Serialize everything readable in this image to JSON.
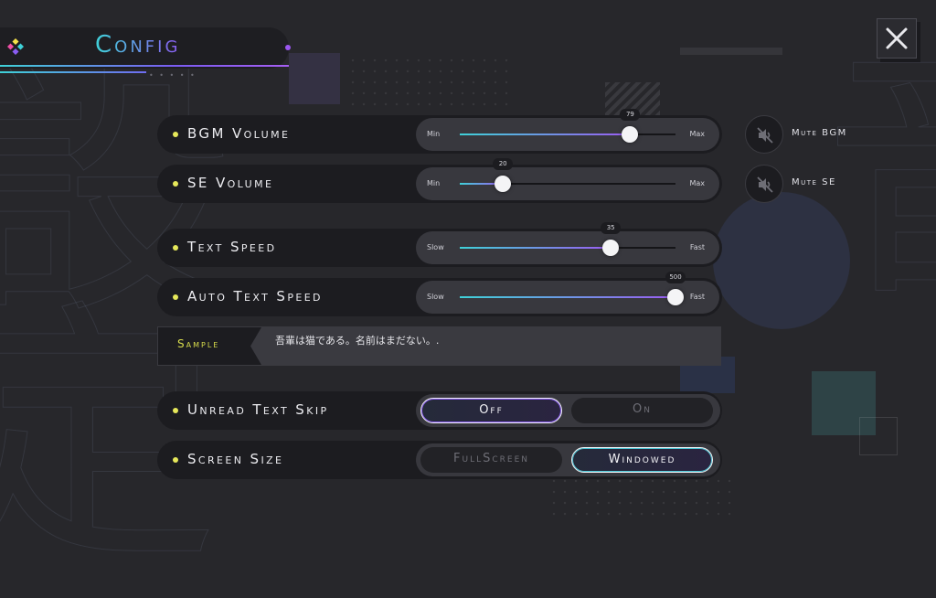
{
  "header": {
    "title": "Config"
  },
  "settings": {
    "bgm": {
      "label": "BGM Volume",
      "min": "Min",
      "max": "Max",
      "value": 79,
      "range": [
        0,
        100
      ]
    },
    "se": {
      "label": "SE Volume",
      "min": "Min",
      "max": "Max",
      "value": 20,
      "range": [
        0,
        100
      ]
    },
    "text_speed": {
      "label": "Text Speed",
      "min": "Slow",
      "max": "Fast",
      "value": 35,
      "range": [
        0,
        50
      ]
    },
    "auto_speed": {
      "label": "Auto Text Speed",
      "min": "Slow",
      "max": "Fast",
      "value": 500,
      "range": [
        0,
        500
      ]
    }
  },
  "mute": {
    "bgm_label": "Mute BGM",
    "se_label": "Mute SE"
  },
  "sample": {
    "label": "Sample",
    "text": "吾輩は猫である。名前はまだない。."
  },
  "unread_skip": {
    "label": "Unread Text Skip",
    "off": "Off",
    "on": "On",
    "selected": "Off"
  },
  "screen_size": {
    "label": "Screen Size",
    "fullscreen": "FullScreen",
    "windowed": "Windowed",
    "selected": "Windowed"
  },
  "colors": {
    "accent_cyan": "#3fd1d8",
    "accent_purple": "#9b5cf2",
    "bullet": "#e6e85a"
  },
  "icons": {
    "close": "close-icon",
    "mute": "speaker-mute-icon",
    "logo": "diamond-cluster-icon"
  }
}
